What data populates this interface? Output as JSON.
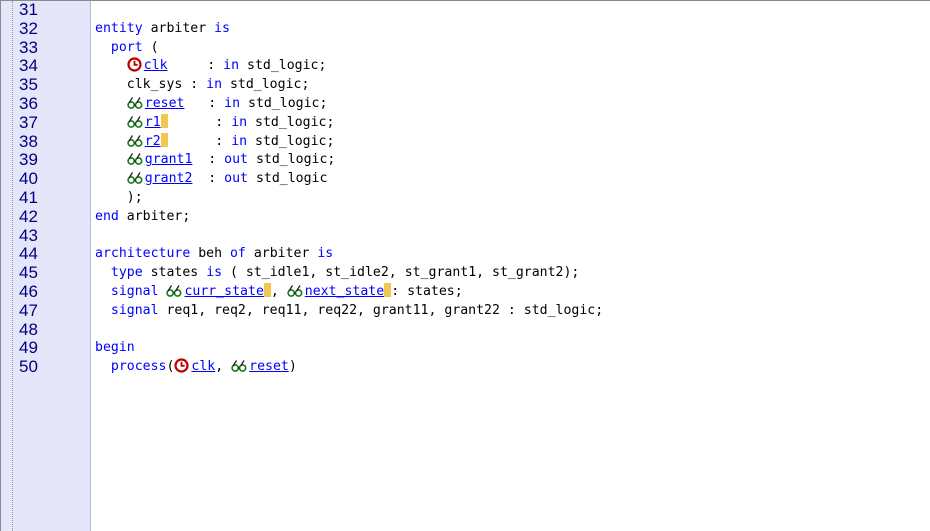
{
  "editor": {
    "lines": [
      {
        "num": "31",
        "segments": []
      },
      {
        "num": "32",
        "segments": [
          {
            "t": "kw",
            "v": "entity"
          },
          {
            "t": "txt",
            "v": " arbiter "
          },
          {
            "t": "kw",
            "v": "is"
          }
        ]
      },
      {
        "num": "33",
        "segments": [
          {
            "t": "txt",
            "v": "  "
          },
          {
            "t": "kw",
            "v": "port"
          },
          {
            "t": "txt",
            "v": " ("
          }
        ]
      },
      {
        "num": "34",
        "segments": [
          {
            "t": "txt",
            "v": "    "
          },
          {
            "t": "icon",
            "v": "clock-icon"
          },
          {
            "t": "lnk",
            "v": "clk"
          },
          {
            "t": "txt",
            "v": "     : "
          },
          {
            "t": "kw",
            "v": "in"
          },
          {
            "t": "txt",
            "v": " std_logic;"
          }
        ]
      },
      {
        "num": "35",
        "segments": [
          {
            "t": "txt",
            "v": "    clk_sys : "
          },
          {
            "t": "kw",
            "v": "in"
          },
          {
            "t": "txt",
            "v": " std_logic;"
          }
        ]
      },
      {
        "num": "36",
        "segments": [
          {
            "t": "txt",
            "v": "    "
          },
          {
            "t": "icon",
            "v": "glasses-icon"
          },
          {
            "t": "lnk",
            "v": "reset"
          },
          {
            "t": "txt",
            "v": "   : "
          },
          {
            "t": "kw",
            "v": "in"
          },
          {
            "t": "txt",
            "v": " std_logic;"
          }
        ]
      },
      {
        "num": "37",
        "segments": [
          {
            "t": "txt",
            "v": "    "
          },
          {
            "t": "icon",
            "v": "glasses-icon"
          },
          {
            "t": "lnk",
            "v": "r1"
          },
          {
            "t": "mark",
            "v": ""
          },
          {
            "t": "txt",
            "v": "      : "
          },
          {
            "t": "kw",
            "v": "in"
          },
          {
            "t": "txt",
            "v": " std_logic;"
          }
        ]
      },
      {
        "num": "38",
        "segments": [
          {
            "t": "txt",
            "v": "    "
          },
          {
            "t": "icon",
            "v": "glasses-icon"
          },
          {
            "t": "lnk",
            "v": "r2"
          },
          {
            "t": "mark",
            "v": ""
          },
          {
            "t": "txt",
            "v": "      : "
          },
          {
            "t": "kw",
            "v": "in"
          },
          {
            "t": "txt",
            "v": " std_logic;"
          }
        ]
      },
      {
        "num": "39",
        "segments": [
          {
            "t": "txt",
            "v": "    "
          },
          {
            "t": "icon",
            "v": "glasses-icon"
          },
          {
            "t": "lnk",
            "v": "grant1"
          },
          {
            "t": "txt",
            "v": "  : "
          },
          {
            "t": "kw",
            "v": "out"
          },
          {
            "t": "txt",
            "v": " std_logic;"
          }
        ]
      },
      {
        "num": "40",
        "segments": [
          {
            "t": "txt",
            "v": "    "
          },
          {
            "t": "icon",
            "v": "glasses-icon"
          },
          {
            "t": "lnk",
            "v": "grant2"
          },
          {
            "t": "txt",
            "v": "  : "
          },
          {
            "t": "kw",
            "v": "out"
          },
          {
            "t": "txt",
            "v": " std_logic"
          }
        ]
      },
      {
        "num": "41",
        "segments": [
          {
            "t": "txt",
            "v": "    );"
          }
        ]
      },
      {
        "num": "42",
        "segments": [
          {
            "t": "kw",
            "v": "end"
          },
          {
            "t": "txt",
            "v": " arbiter;"
          }
        ]
      },
      {
        "num": "43",
        "segments": []
      },
      {
        "num": "44",
        "segments": [
          {
            "t": "kw",
            "v": "architecture"
          },
          {
            "t": "txt",
            "v": " beh "
          },
          {
            "t": "kw",
            "v": "of"
          },
          {
            "t": "txt",
            "v": " arbiter "
          },
          {
            "t": "kw",
            "v": "is"
          }
        ]
      },
      {
        "num": "45",
        "segments": [
          {
            "t": "txt",
            "v": "  "
          },
          {
            "t": "kw",
            "v": "type"
          },
          {
            "t": "txt",
            "v": " states "
          },
          {
            "t": "kw",
            "v": "is"
          },
          {
            "t": "txt",
            "v": " ( st_idle1, st_idle2, st_grant1, st_grant2);"
          }
        ]
      },
      {
        "num": "46",
        "segments": [
          {
            "t": "txt",
            "v": "  "
          },
          {
            "t": "kw",
            "v": "signal"
          },
          {
            "t": "txt",
            "v": " "
          },
          {
            "t": "icon",
            "v": "glasses-icon"
          },
          {
            "t": "lnk",
            "v": "curr_state"
          },
          {
            "t": "mark",
            "v": ""
          },
          {
            "t": "txt",
            "v": ", "
          },
          {
            "t": "icon",
            "v": "glasses-icon"
          },
          {
            "t": "lnk",
            "v": "next_state"
          },
          {
            "t": "mark",
            "v": ""
          },
          {
            "t": "txt",
            "v": ": states;"
          }
        ]
      },
      {
        "num": "47",
        "segments": [
          {
            "t": "txt",
            "v": "  "
          },
          {
            "t": "kw",
            "v": "signal"
          },
          {
            "t": "txt",
            "v": " req1, req2, req11, req22, grant11, grant22 : std_logic;"
          }
        ]
      },
      {
        "num": "48",
        "segments": []
      },
      {
        "num": "49",
        "segments": [
          {
            "t": "kw",
            "v": "begin"
          }
        ]
      },
      {
        "num": "50",
        "segments": [
          {
            "t": "txt",
            "v": "  "
          },
          {
            "t": "kw",
            "v": "process"
          },
          {
            "t": "txt",
            "v": "("
          },
          {
            "t": "icon",
            "v": "clock-icon"
          },
          {
            "t": "lnk",
            "v": "clk"
          },
          {
            "t": "txt",
            "v": ", "
          },
          {
            "t": "icon",
            "v": "glasses-icon"
          },
          {
            "t": "lnk",
            "v": "reset"
          },
          {
            "t": "txt",
            "v": ")"
          }
        ]
      }
    ]
  },
  "colors": {
    "keyword": "#0000ff",
    "link": "#0000ff",
    "line_number": "#000080",
    "gutter_bg": "#e6e6fa",
    "marker": "#f0c850",
    "clock_icon": "#c00000",
    "glasses_icon": "#1a7a1a"
  }
}
